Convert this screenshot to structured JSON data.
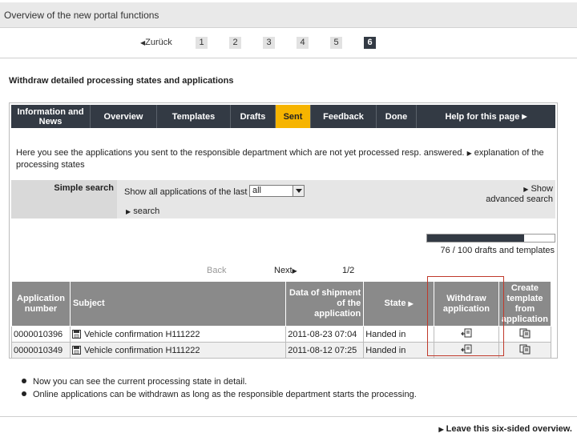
{
  "header": {
    "title": "Overview of the new portal functions"
  },
  "pager": {
    "back_label": "Zurück",
    "pages": [
      "1",
      "2",
      "3",
      "4",
      "5",
      "6"
    ],
    "active_page": "6"
  },
  "section": {
    "title": "Withdraw detailed processing states and applications"
  },
  "tabs": [
    {
      "label": "Information and News"
    },
    {
      "label": "Overview"
    },
    {
      "label": "Templates"
    },
    {
      "label": "Drafts"
    },
    {
      "label": "Sent",
      "active": true
    },
    {
      "label": "Feedback"
    },
    {
      "label": "Done"
    },
    {
      "label": "Help for this page"
    }
  ],
  "intro": {
    "text": "Here you see the applications you sent to the responsible department which are not yet processed resp. answered.",
    "link": "explanation of the processing states"
  },
  "search": {
    "label": "Simple search",
    "show_text": "Show all applications of the last :",
    "select_value": "all",
    "search_link": "search",
    "advanced_line1": "Show",
    "advanced_line2": "advanced search"
  },
  "quota": {
    "used": 76,
    "total": 100,
    "text": "76 / 100 drafts and templates"
  },
  "list_pager": {
    "back": "Back",
    "next": "Next",
    "page": "1/2"
  },
  "table": {
    "headers": {
      "app_number": "Application number",
      "subject": "Subject",
      "shipment": "Data of shipment of the application",
      "state": "State",
      "withdraw": "Withdraw application",
      "template": "Create template from application"
    },
    "rows": [
      {
        "number": "0000010396",
        "subject": "Vehicle confirmation H111222",
        "date": "2011-08-23 07:04",
        "state": "Handed in"
      },
      {
        "number": "0000010349",
        "subject": "Vehicle confirmation H111222",
        "date": "2011-08-12 07:25",
        "state": "Handed in"
      }
    ]
  },
  "notes": [
    "Now you can see the current processing state in detail.",
    "Online applications can be withdrawn as long as the responsible department starts the processing."
  ],
  "footer": {
    "leave_link": "Leave this six-sided overview."
  },
  "colors": {
    "nav_dark": "#333a44",
    "tab_active": "#f6b400",
    "header_gray": "#8a8a8a",
    "highlight_red": "#c0392b"
  }
}
